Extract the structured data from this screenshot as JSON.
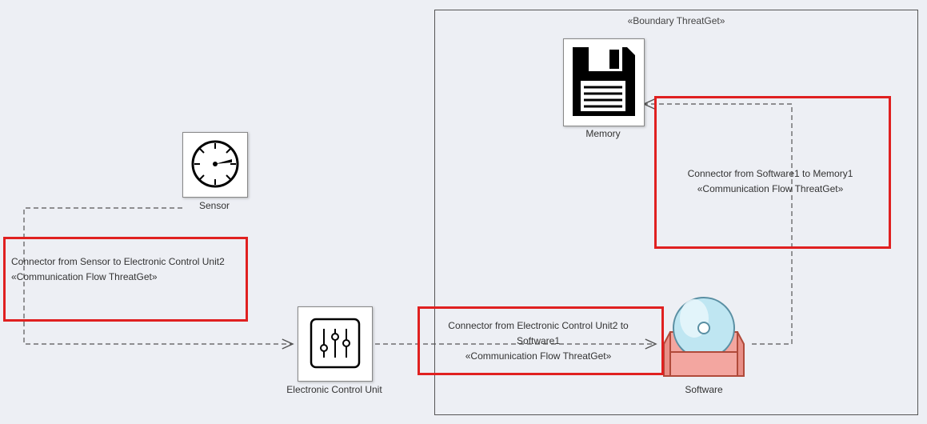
{
  "boundary": {
    "label": "«Boundary ThreatGet»"
  },
  "nodes": {
    "sensor": {
      "label": "Sensor"
    },
    "ecu": {
      "label": "Electronic Control Unit"
    },
    "memory": {
      "label": "Memory"
    },
    "software": {
      "label": "Software"
    }
  },
  "connectors": {
    "sensor_to_ecu": {
      "line1": "Connector from Sensor to Electronic Control Unit2",
      "line2": "«Communication Flow ThreatGet»"
    },
    "ecu_to_software": {
      "line1": "Connector from Electronic Control Unit2 to Software1",
      "line2": "«Communication Flow ThreatGet»"
    },
    "software_to_memory": {
      "line1": "Connector from Software1 to Memory1",
      "line2": "«Communication Flow ThreatGet»"
    }
  }
}
